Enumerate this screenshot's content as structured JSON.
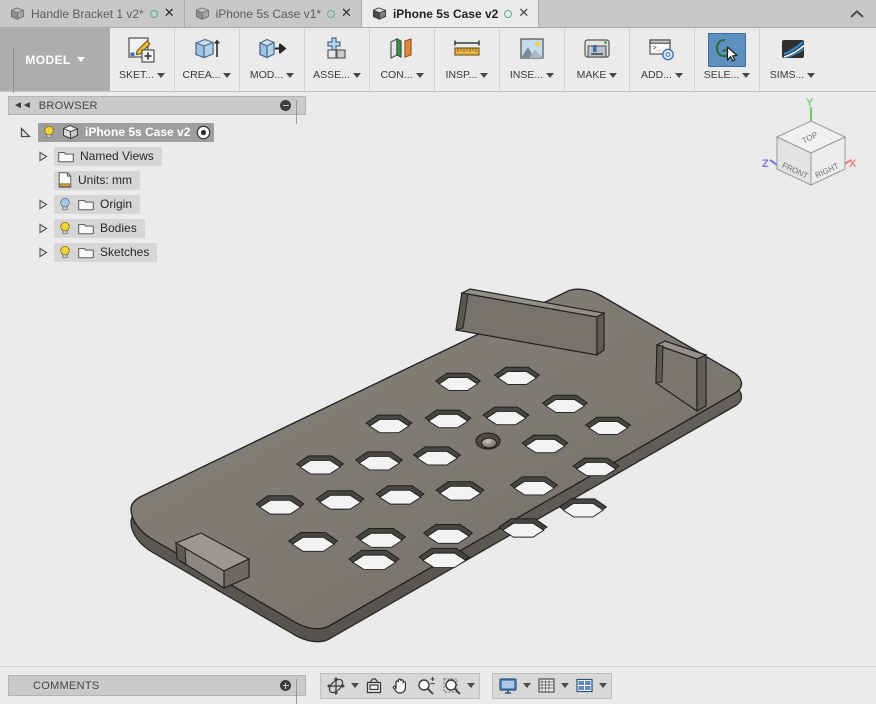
{
  "window": {
    "app": "Fusion 360",
    "collapse_icon": "chevron-up-icon"
  },
  "tabs": [
    {
      "label": "Handle Bracket 1 v2*",
      "active": false,
      "icon": "cube-icon",
      "status_dot": "unsaved-dot",
      "close": "✕"
    },
    {
      "label": "iPhone 5s Case v1*",
      "active": false,
      "icon": "cube-icon",
      "status_dot": "unsaved-dot",
      "close": "✕"
    },
    {
      "label": "iPhone 5s Case v2",
      "active": true,
      "icon": "cube-icon",
      "status_dot": "unsaved-dot",
      "close": "✕"
    }
  ],
  "ribbon": {
    "workspace_label": "MODEL",
    "groups": [
      {
        "label": "SKET...",
        "icon": "sketch-icon",
        "selected": false
      },
      {
        "label": "CREA...",
        "icon": "create-icon",
        "selected": false
      },
      {
        "label": "MOD...",
        "icon": "modify-icon",
        "selected": false
      },
      {
        "label": "ASSE...",
        "icon": "assemble-icon",
        "selected": false
      },
      {
        "label": "CON...",
        "icon": "construct-icon",
        "selected": false
      },
      {
        "label": "INSP...",
        "icon": "inspect-icon",
        "selected": false
      },
      {
        "label": "INSE...",
        "icon": "insert-icon",
        "selected": false
      },
      {
        "label": "MAKE",
        "icon": "make-icon",
        "selected": false
      },
      {
        "label": "ADD...",
        "icon": "addins-icon",
        "selected": false
      },
      {
        "label": "SELE...",
        "icon": "select-icon",
        "selected": true
      },
      {
        "label": "SIMS...",
        "icon": "simscale-icon",
        "selected": false
      }
    ]
  },
  "browser": {
    "title": "BROWSER",
    "collapse_icon": "double-chevron-left-icon",
    "minimize_icon": "minus-circle-icon",
    "tree": [
      {
        "label": "iPhone 5s Case v2",
        "level": 0,
        "arrow": "expanded",
        "bulb": "on",
        "icon": "cube-icon",
        "root": true,
        "target": true
      },
      {
        "label": "Named Views",
        "level": 1,
        "arrow": "collapsed",
        "bulb": "none",
        "icon": "folder-icon",
        "root": false,
        "target": false
      },
      {
        "label": "Units: mm",
        "level": 1,
        "arrow": "none",
        "bulb": "none",
        "icon": "units-icon",
        "root": false,
        "target": false
      },
      {
        "label": "Origin",
        "level": 1,
        "arrow": "collapsed",
        "bulb": "off",
        "icon": "folder-icon",
        "root": false,
        "target": false
      },
      {
        "label": "Bodies",
        "level": 1,
        "arrow": "collapsed",
        "bulb": "on",
        "icon": "folder-icon",
        "root": false,
        "target": false
      },
      {
        "label": "Sketches",
        "level": 1,
        "arrow": "collapsed",
        "bulb": "on",
        "icon": "folder-icon",
        "root": false,
        "target": false
      }
    ]
  },
  "viewcube": {
    "faces": {
      "top": "TOP",
      "front": "FRONT",
      "right": "RIGHT"
    },
    "axes": [
      {
        "label": "X",
        "color": "#e8807f"
      },
      {
        "label": "Y",
        "color": "#74cc74"
      },
      {
        "label": "Z",
        "color": "#7b7bdd"
      }
    ]
  },
  "model": {
    "name": "iPhone 5s Case v2",
    "description": "Phone case shell with honeycomb hexagonal cutout pattern, four corner retaining clips and one circular camera hole",
    "hex_hole_count": 23,
    "round_hole_count": 1,
    "colors": {
      "body_top": "#7c7972",
      "body_top_shade": "#74716a",
      "body_side": "#5d5a55",
      "hole_wall": "#4c4a47",
      "hole_floor": "#f4f4f4",
      "edge": "#2e2e2e"
    }
  },
  "footer": {
    "comments_label": "COMMENTS",
    "comments_add_icon": "plus-circle-icon",
    "nav_group_1": [
      {
        "icon": "orbit-icon",
        "caret": true
      },
      {
        "icon": "look-at-icon",
        "caret": false
      },
      {
        "icon": "pan-hand-icon",
        "caret": false
      },
      {
        "icon": "zoom-icon",
        "caret": false
      },
      {
        "icon": "zoom-window-icon",
        "caret": true
      }
    ],
    "nav_group_2": [
      {
        "icon": "display-settings-icon",
        "caret": true
      },
      {
        "icon": "grid-snap-icon",
        "caret": true
      },
      {
        "icon": "viewports-icon",
        "caret": true
      }
    ]
  },
  "theme": {
    "viewport_bg": "#ebebeb",
    "chrome_bg": "#ebebeb",
    "panel_bg": "#cacaca",
    "tab_inactive": "#c8c8c8",
    "accent_select": "#5e90bf",
    "bulb_on": "#f5d33a",
    "bulb_off": "#a9c6e4"
  }
}
